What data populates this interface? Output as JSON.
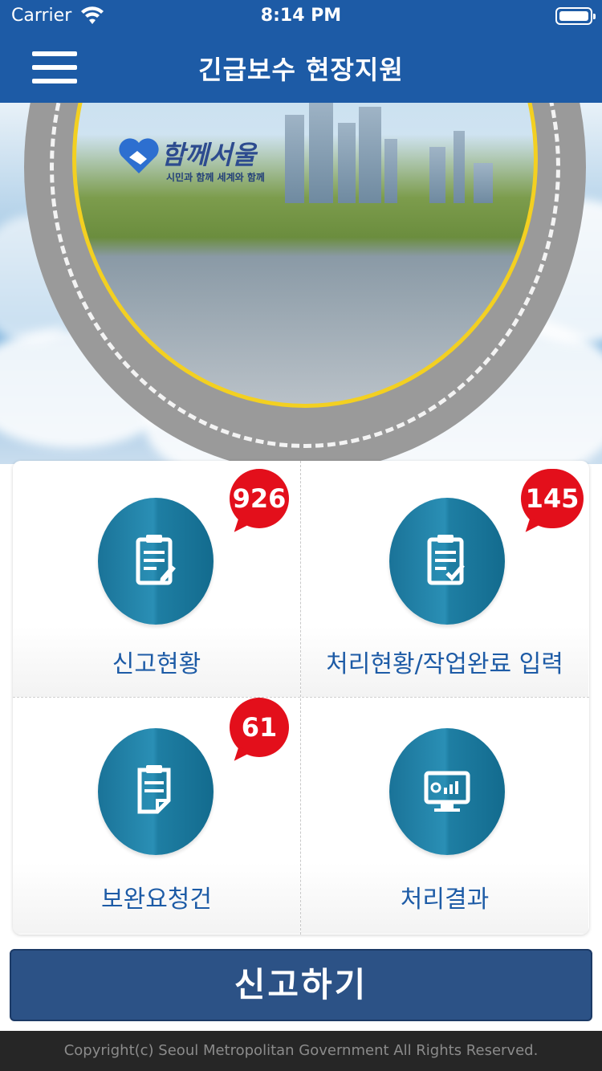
{
  "status_bar": {
    "carrier": "Carrier",
    "time": "8:14 PM"
  },
  "nav": {
    "title": "긴급보수 현장지원",
    "menu_icon": "hamburger-menu-icon"
  },
  "hero": {
    "logo_text": "함께서울",
    "logo_sub": "시민과 함께 세계와 함께"
  },
  "menu": [
    {
      "label": "신고현황",
      "badge": "926",
      "icon": "clipboard-edit-icon"
    },
    {
      "label": "처리현황/작업완료 입력",
      "badge": "145",
      "icon": "clipboard-check-icon"
    },
    {
      "label": "보완요청건",
      "badge": "61",
      "icon": "document-icon"
    },
    {
      "label": "처리결과",
      "badge": null,
      "icon": "monitor-chart-icon"
    }
  ],
  "report_button": "신고하기",
  "footer": "Copyright(c) Seoul Metropolitan Government All Rights Reserved.",
  "colors": {
    "primary": "#1d5ba6",
    "circle": "#1a7398",
    "badge": "#e30f1b",
    "button": "#2c5286",
    "footer_bg": "#262626"
  }
}
